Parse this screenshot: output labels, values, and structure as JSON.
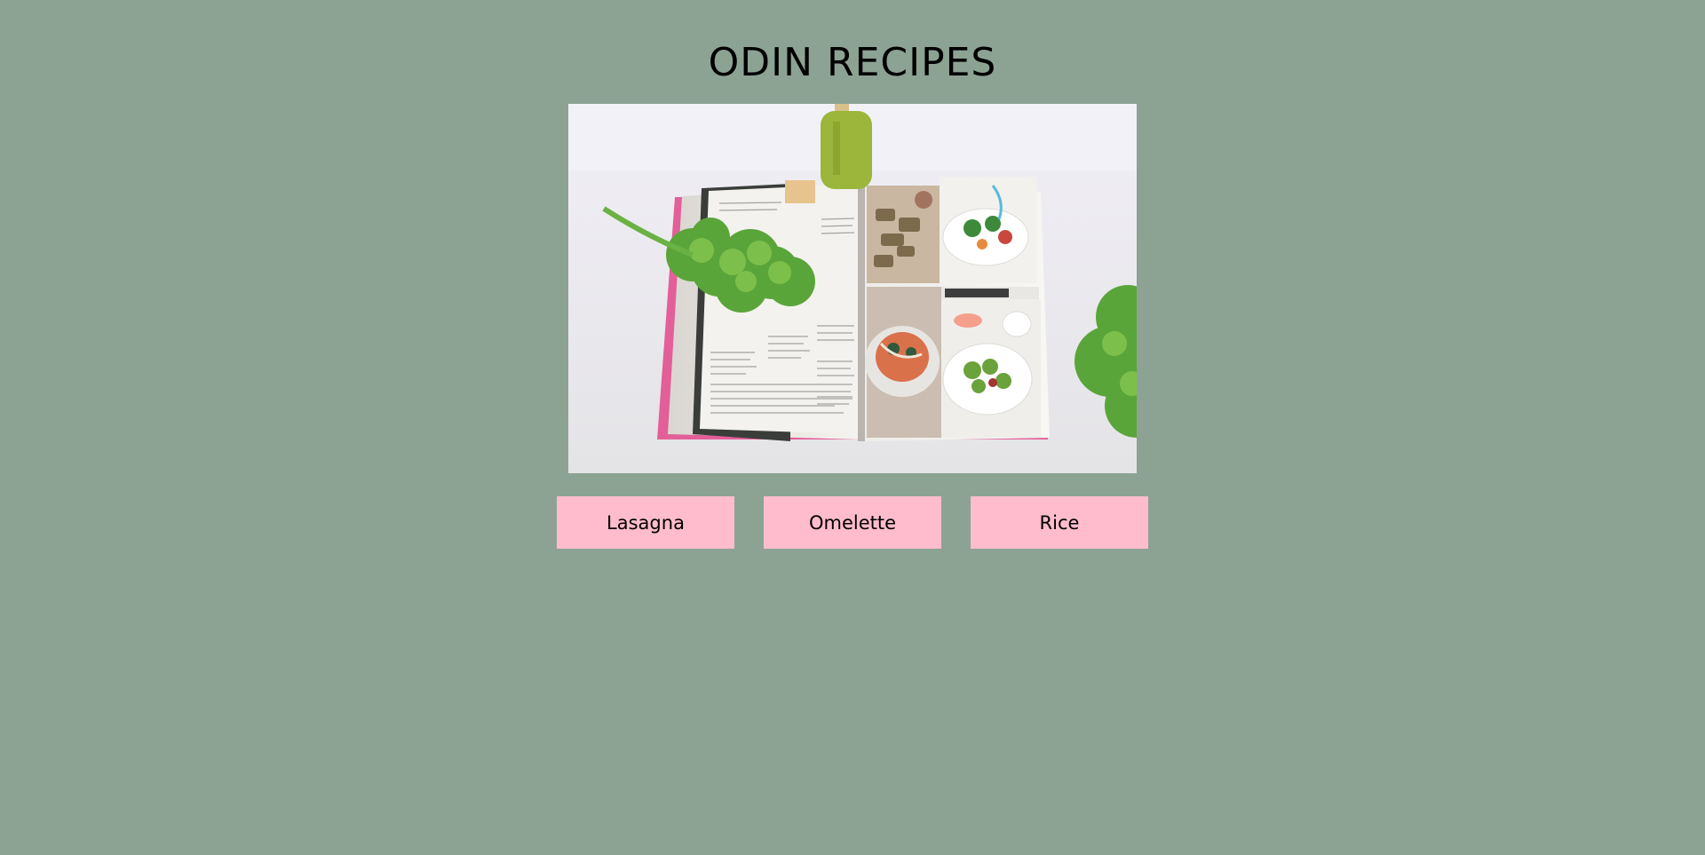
{
  "page": {
    "title": "ODIN RECIPES",
    "background_color": "#8ca393"
  },
  "hero_image": {
    "description_icon": "cookbook-photo"
  },
  "recipes": [
    {
      "label": "Lasagna"
    },
    {
      "label": "Omelette"
    },
    {
      "label": "Rice"
    }
  ],
  "colors": {
    "button_bg": "#ffbccd",
    "text": "#000000"
  }
}
